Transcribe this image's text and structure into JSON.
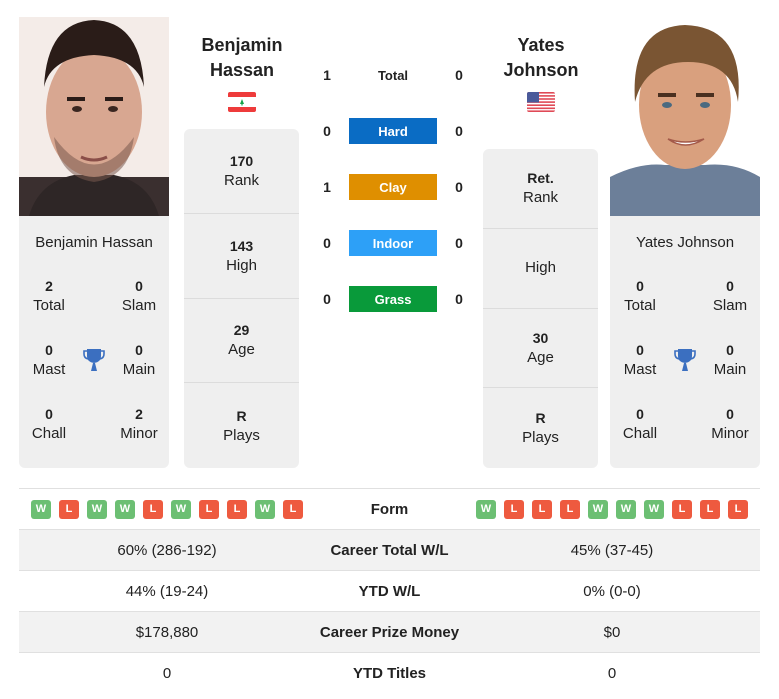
{
  "colors": {
    "hard": "#0a6cc4",
    "clay": "#df8f00",
    "indoor": "#2da0f7",
    "grass": "#099a3a",
    "win": "#6cbf73",
    "loss": "#ee5a3f",
    "trophy": "#3b6fc0",
    "card_bg": "#efefef"
  },
  "player1": {
    "name_line1": "Benjamin",
    "name_line2": "Hassan",
    "full_name": "Benjamin Hassan",
    "flag": "lebanon-flag",
    "info": [
      {
        "value": "170",
        "label": "Rank"
      },
      {
        "value": "143",
        "label": "High"
      },
      {
        "value": "29",
        "label": "Age"
      },
      {
        "value": "R",
        "label": "Plays"
      }
    ],
    "titles": {
      "total": {
        "value": "2",
        "label": "Total"
      },
      "slam": {
        "value": "0",
        "label": "Slam"
      },
      "mast": {
        "value": "0",
        "label": "Mast"
      },
      "main": {
        "value": "0",
        "label": "Main"
      },
      "chall": {
        "value": "0",
        "label": "Chall"
      },
      "minor": {
        "value": "2",
        "label": "Minor"
      }
    },
    "form": [
      "W",
      "L",
      "W",
      "W",
      "L",
      "W",
      "L",
      "L",
      "W",
      "L"
    ],
    "career_wl": "60% (286-192)",
    "ytd_wl": "44% (19-24)",
    "prize_money": "$178,880",
    "ytd_titles": "0"
  },
  "player2": {
    "name_line1": "Yates",
    "name_line2": "Johnson",
    "full_name": "Yates Johnson",
    "flag": "usa-flag",
    "info": [
      {
        "value": "Ret.",
        "label": "Rank"
      },
      {
        "value": "",
        "label": "High"
      },
      {
        "value": "30",
        "label": "Age"
      },
      {
        "value": "R",
        "label": "Plays"
      }
    ],
    "titles": {
      "total": {
        "value": "0",
        "label": "Total"
      },
      "slam": {
        "value": "0",
        "label": "Slam"
      },
      "mast": {
        "value": "0",
        "label": "Mast"
      },
      "main": {
        "value": "0",
        "label": "Main"
      },
      "chall": {
        "value": "0",
        "label": "Chall"
      },
      "minor": {
        "value": "0",
        "label": "Minor"
      }
    },
    "form": [
      "W",
      "L",
      "L",
      "L",
      "W",
      "W",
      "W",
      "L",
      "L",
      "L"
    ],
    "career_wl": "45% (37-45)",
    "ytd_wl": "0% (0-0)",
    "prize_money": "$0",
    "ytd_titles": "0"
  },
  "h2h": [
    {
      "label": "Total",
      "p1": "1",
      "p2": "0",
      "surface": "total"
    },
    {
      "label": "Hard",
      "p1": "0",
      "p2": "0",
      "surface": "hard"
    },
    {
      "label": "Clay",
      "p1": "1",
      "p2": "0",
      "surface": "clay"
    },
    {
      "label": "Indoor",
      "p1": "0",
      "p2": "0",
      "surface": "indoor"
    },
    {
      "label": "Grass",
      "p1": "0",
      "p2": "0",
      "surface": "grass"
    }
  ],
  "stat_labels": {
    "form": "Form",
    "career_wl": "Career Total W/L",
    "ytd_wl": "YTD W/L",
    "prize_money": "Career Prize Money",
    "ytd_titles": "YTD Titles"
  }
}
